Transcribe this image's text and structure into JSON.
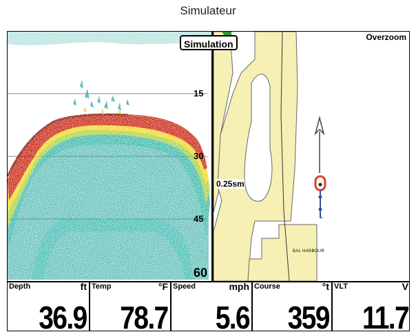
{
  "caption": "Simulateur",
  "badge": "Simulation",
  "chart": {
    "mode": "Overzoom",
    "range": "0.25sm",
    "place": "BAL HARBOUR"
  },
  "sonar": {
    "depth_marks": [
      "15",
      "30",
      "45",
      "60"
    ]
  },
  "databar": [
    {
      "name": "Depth",
      "unit": "ft",
      "value": "36.9"
    },
    {
      "name": "Temp",
      "unit": "°F",
      "value": "78.7"
    },
    {
      "name": "Speed",
      "unit": "mph",
      "value": "5.6"
    },
    {
      "name": "Course",
      "unit": "°t",
      "value": "359"
    },
    {
      "name": "VLT",
      "unit": "V",
      "value": "11.7"
    }
  ],
  "colors": {
    "land": "#f7f0b4",
    "water": "#ffffff",
    "sonar_strong": "#c81e0a",
    "sonar_mid": "#e8d020",
    "sonar_weak": "#2aa8a0",
    "cursor": "#e04020"
  }
}
